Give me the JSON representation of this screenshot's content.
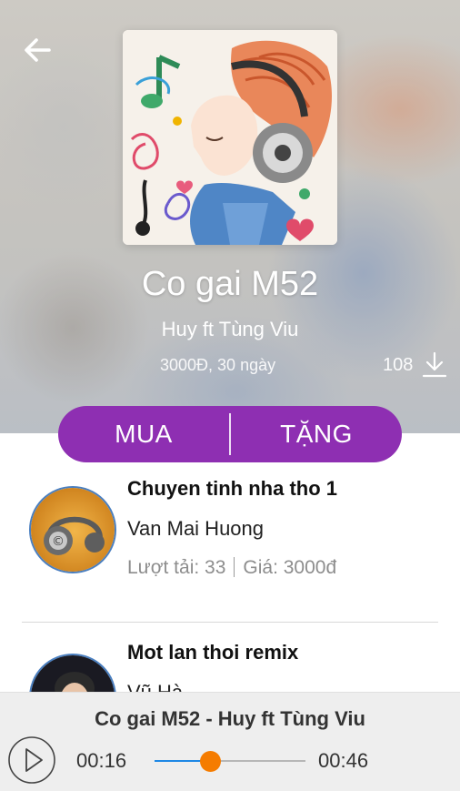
{
  "header": {
    "back_icon": "back-arrow-icon"
  },
  "song": {
    "title": "Co gai M52",
    "artist": "Huy ft Tùng Viu",
    "price_info": "3000Đ, 30 ngày",
    "download_count": "108",
    "download_icon": "download-icon"
  },
  "actions": {
    "buy_label": "MUA",
    "gift_label": "TẶNG",
    "color": "#8e2fb2"
  },
  "song_list": [
    {
      "name": "Chuyen tinh nha tho 1",
      "artist": "Van Mai Huong",
      "downloads_label": "Lượt tải: 33",
      "price_label": "Giá: 3000đ"
    },
    {
      "name": "Mot lan thoi remix",
      "artist": "Vũ Hà"
    }
  ],
  "player": {
    "now_playing": "Co gai M52 - Huy ft Tùng Viu",
    "current_time": "00:16",
    "total_time": "00:46",
    "progress": 0.37,
    "play_icon": "play-icon",
    "track_color": "#1e88e5",
    "thumb_color": "#f57c00"
  }
}
